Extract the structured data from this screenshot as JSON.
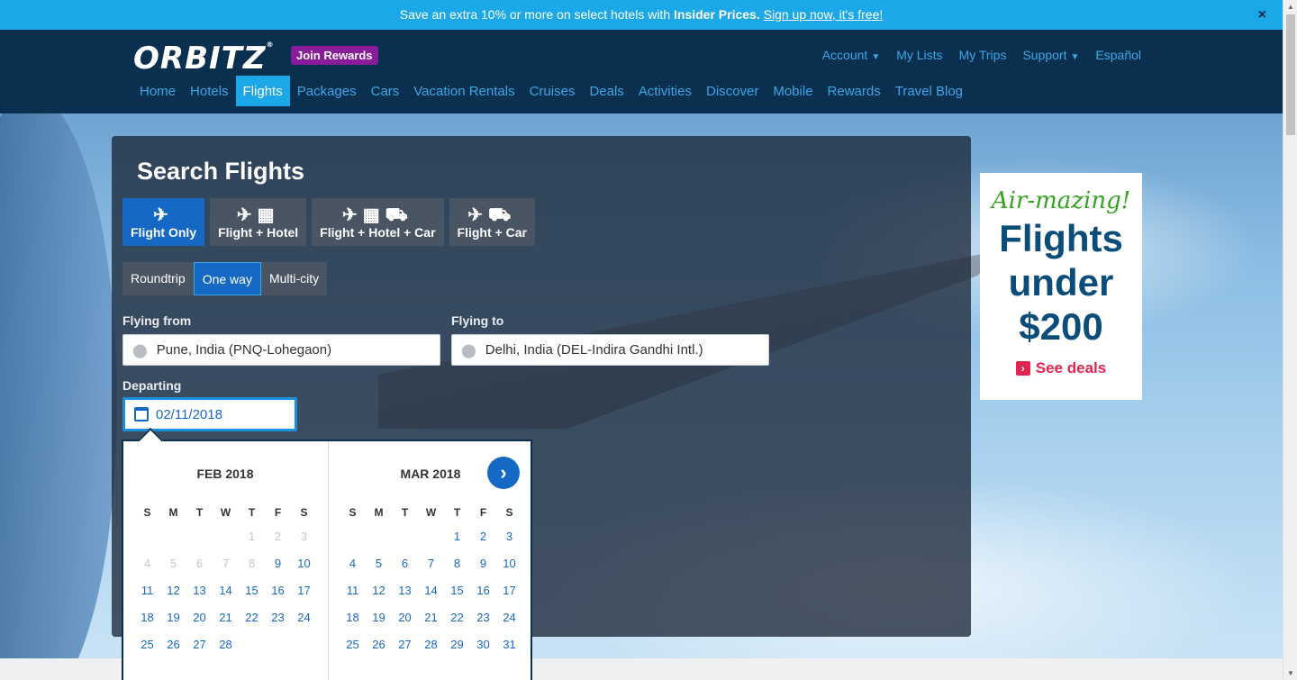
{
  "promo": {
    "text_before": "Save an extra 10% or more on select hotels with ",
    "bold": "Insider Prices.",
    "link": "Sign up now, it's free!",
    "close": "×"
  },
  "header": {
    "logo": "ORBITZ",
    "join": "Join Rewards",
    "util": {
      "account": "Account",
      "lists": "My Lists",
      "trips": "My Trips",
      "support": "Support",
      "lang": "Español"
    },
    "nav": [
      "Home",
      "Hotels",
      "Flights",
      "Packages",
      "Cars",
      "Vacation Rentals",
      "Cruises",
      "Deals",
      "Activities",
      "Discover",
      "Mobile",
      "Rewards",
      "Travel Blog"
    ],
    "active_nav": "Flights"
  },
  "search": {
    "title": "Search Flights",
    "product_tabs": [
      "Flight Only",
      "Flight + Hotel",
      "Flight + Hotel + Car",
      "Flight + Car"
    ],
    "trip_types": [
      "Roundtrip",
      "One way",
      "Multi-city"
    ],
    "from_label": "Flying from",
    "from_value": "Pune, India (PNQ-Lohegaon)",
    "to_label": "Flying to",
    "to_value": "Delhi, India (DEL-Indira Gandhi Intl.)",
    "depart_label": "Departing",
    "depart_value": "02/11/2018"
  },
  "calendar": {
    "weekdays": [
      "S",
      "M",
      "T",
      "W",
      "T",
      "F",
      "S"
    ],
    "month1": {
      "title": "FEB 2018",
      "lead_blank": 4,
      "disabled_days": [
        1,
        2,
        3,
        4,
        5,
        6,
        7,
        8
      ],
      "days": 28
    },
    "month2": {
      "title": "MAR 2018",
      "lead_blank": 4,
      "disabled_days": [],
      "days": 31
    }
  },
  "ad": {
    "tagline": "Air-mazing!",
    "line1": "Flights",
    "line2": "under",
    "line3": "$200",
    "cta": "See deals"
  }
}
